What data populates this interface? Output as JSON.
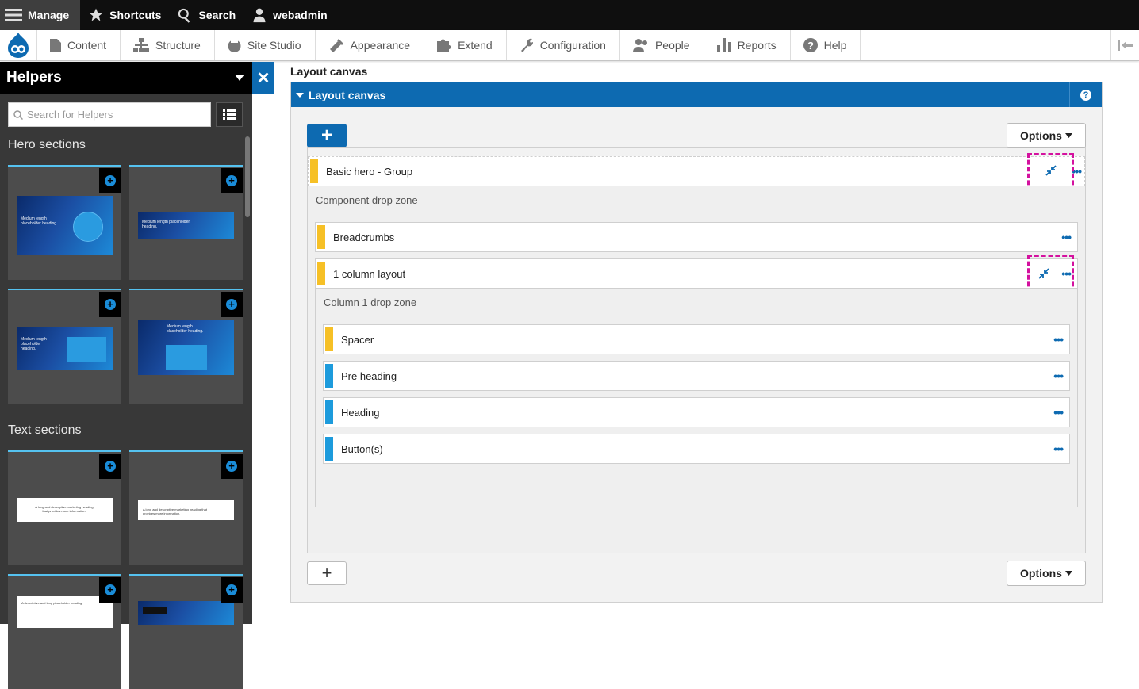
{
  "toolbar": {
    "manage": "Manage",
    "shortcuts": "Shortcuts",
    "search": "Search",
    "user": "webadmin"
  },
  "menu": {
    "items": [
      {
        "label": "Content",
        "icon": "file-icon"
      },
      {
        "label": "Structure",
        "icon": "sitemap-icon"
      },
      {
        "label": "Site Studio",
        "icon": "site-studio-icon"
      },
      {
        "label": "Appearance",
        "icon": "paintbrush-icon"
      },
      {
        "label": "Extend",
        "icon": "puzzle-icon"
      },
      {
        "label": "Configuration",
        "icon": "wrench-icon"
      },
      {
        "label": "People",
        "icon": "people-icon"
      },
      {
        "label": "Reports",
        "icon": "bar-chart-icon"
      },
      {
        "label": "Help",
        "icon": "help-icon"
      }
    ]
  },
  "sidebar": {
    "title": "Helpers",
    "search_placeholder": "Search for Helpers",
    "sections": [
      "Hero sections",
      "Text sections"
    ],
    "hero_thumbs": [
      {
        "text": "Medium length placeholder heading."
      },
      {
        "text": "Medium length placeholder heading."
      },
      {
        "text": "Medium length placeholder heading."
      },
      {
        "text": "Medium length placeholder heading."
      }
    ],
    "text_thumbs": [
      {
        "text": "A long and descriptive marketing heading that provides more information."
      },
      {
        "text": "A long and descriptive marketing heading that provides more information."
      },
      {
        "text": "A descriptive and long placeholder heading"
      },
      {
        "text": ""
      }
    ]
  },
  "main": {
    "field_label": "Layout canvas",
    "panel_title": "Layout canvas",
    "help": "?",
    "add_symbol": "+",
    "options_label": "Options",
    "group_row": "Basic hero - Group",
    "component_zone": "Component drop zone",
    "breadcrumbs_row": "Breadcrumbs",
    "layout_row": "1 column layout",
    "column_zone": "Column 1 drop zone",
    "children": [
      "Spacer",
      "Pre heading",
      "Heading",
      "Button(s)"
    ],
    "dots": "•••"
  },
  "colors": {
    "accent_blue": "#0d6ab1",
    "layout_bar": "#f6c026",
    "element_bar": "#1d9bdc",
    "highlight": "#d4119f"
  }
}
